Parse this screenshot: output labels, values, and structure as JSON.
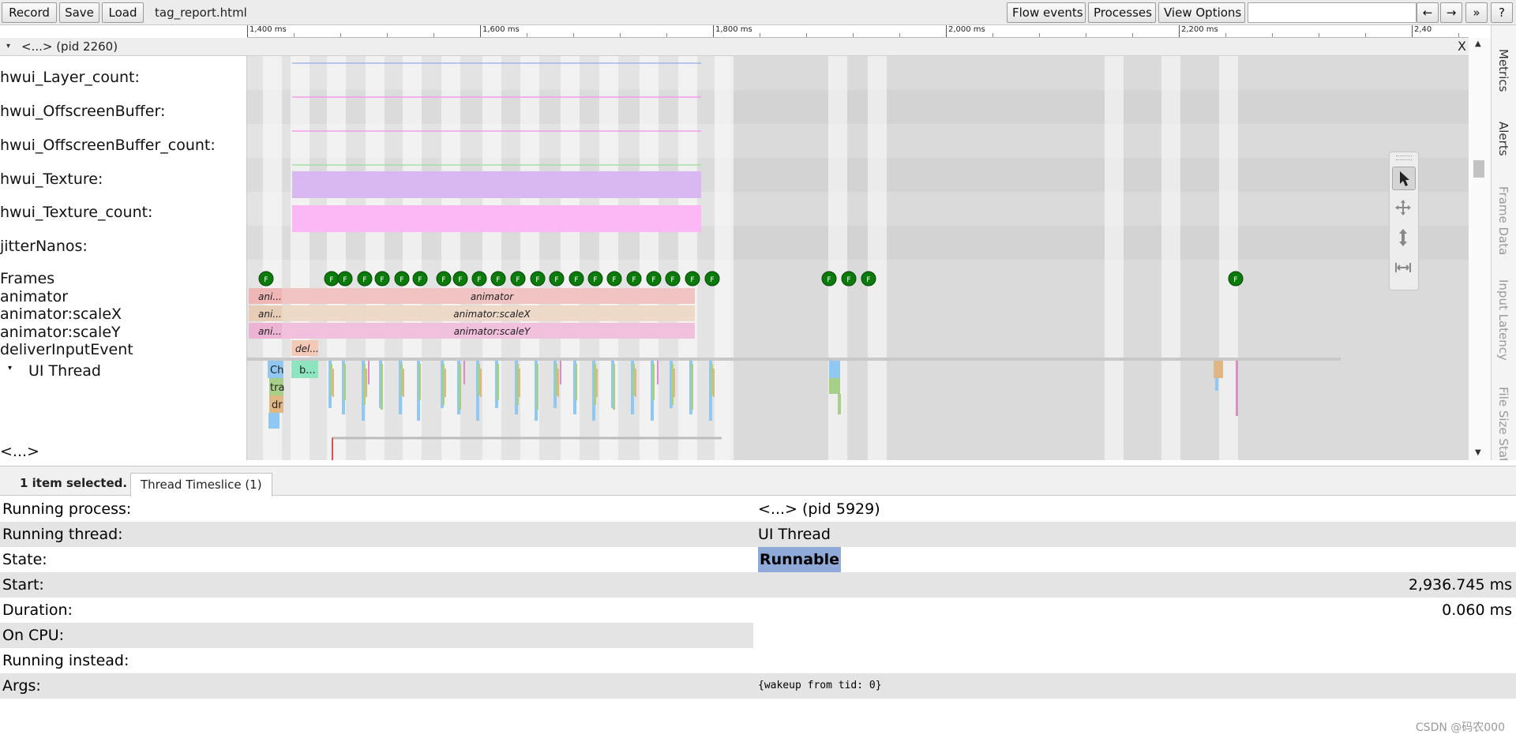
{
  "toolbar": {
    "record": "Record",
    "save": "Save",
    "load": "Load",
    "file_name": "tag_report.html",
    "flow_events": "Flow events",
    "processes": "Processes",
    "view_options": "View Options",
    "search_value": "",
    "nav_back": "←",
    "nav_forward": "→",
    "more": "»",
    "help": "?"
  },
  "ruler": {
    "ticks": [
      "1,400 ms",
      "1,600 ms",
      "1,800 ms",
      "2,000 ms",
      "2,200 ms",
      "2,40"
    ]
  },
  "process": {
    "toggle": "▾",
    "title": "<...> (pid 2260)",
    "close": "X"
  },
  "tracks": [
    "hwui_Layer_count:",
    "hwui_OffscreenBuffer:",
    "hwui_OffscreenBuffer_count:",
    "hwui_Texture:",
    "hwui_Texture_count:",
    "jitterNanos:",
    "Frames",
    "animator",
    "animator:scaleX",
    "animator:scaleY",
    "deliverInputEvent",
    "UI Thread",
    "<...>"
  ],
  "thread_toggle": "▾",
  "slices": {
    "animator_short": "ani...",
    "animator": "animator",
    "animator_scalex": "animator:scaleX",
    "animator_scaley": "animator:scaleY",
    "deliver_short": "del...",
    "ui_ch": "Ch",
    "ui_b": "b...",
    "ui_tra": "tra",
    "ui_dr": "dr",
    "frame_marker": "F"
  },
  "side_tabs": [
    "Metrics",
    "Alerts",
    "Frame Data",
    "Input Latency",
    "File Size Stat"
  ],
  "bottom": {
    "selection": "1 item selected.",
    "tab": "Thread Timeslice (1)",
    "rows": [
      {
        "key": "Running process:",
        "value": "<...> (pid 5929)"
      },
      {
        "key": "Running thread:",
        "value": "UI Thread"
      },
      {
        "key": "State:",
        "value": "Runnable"
      },
      {
        "key": "Start:",
        "value": "2,936.745 ms"
      },
      {
        "key": "Duration:",
        "value": "0.060 ms"
      },
      {
        "key": "On CPU:",
        "value": ""
      },
      {
        "key": "Running instead:",
        "value": ""
      },
      {
        "key": "Args:",
        "value": "{wakeup from tid: 0}"
      }
    ]
  },
  "watermark": "CSDN @码农000",
  "colors": {
    "frame_marker": "#0a7a0a",
    "texture": "#d9b8f2",
    "texture_count": "#fbb8f4",
    "selected_state": "#8fa9d8"
  }
}
